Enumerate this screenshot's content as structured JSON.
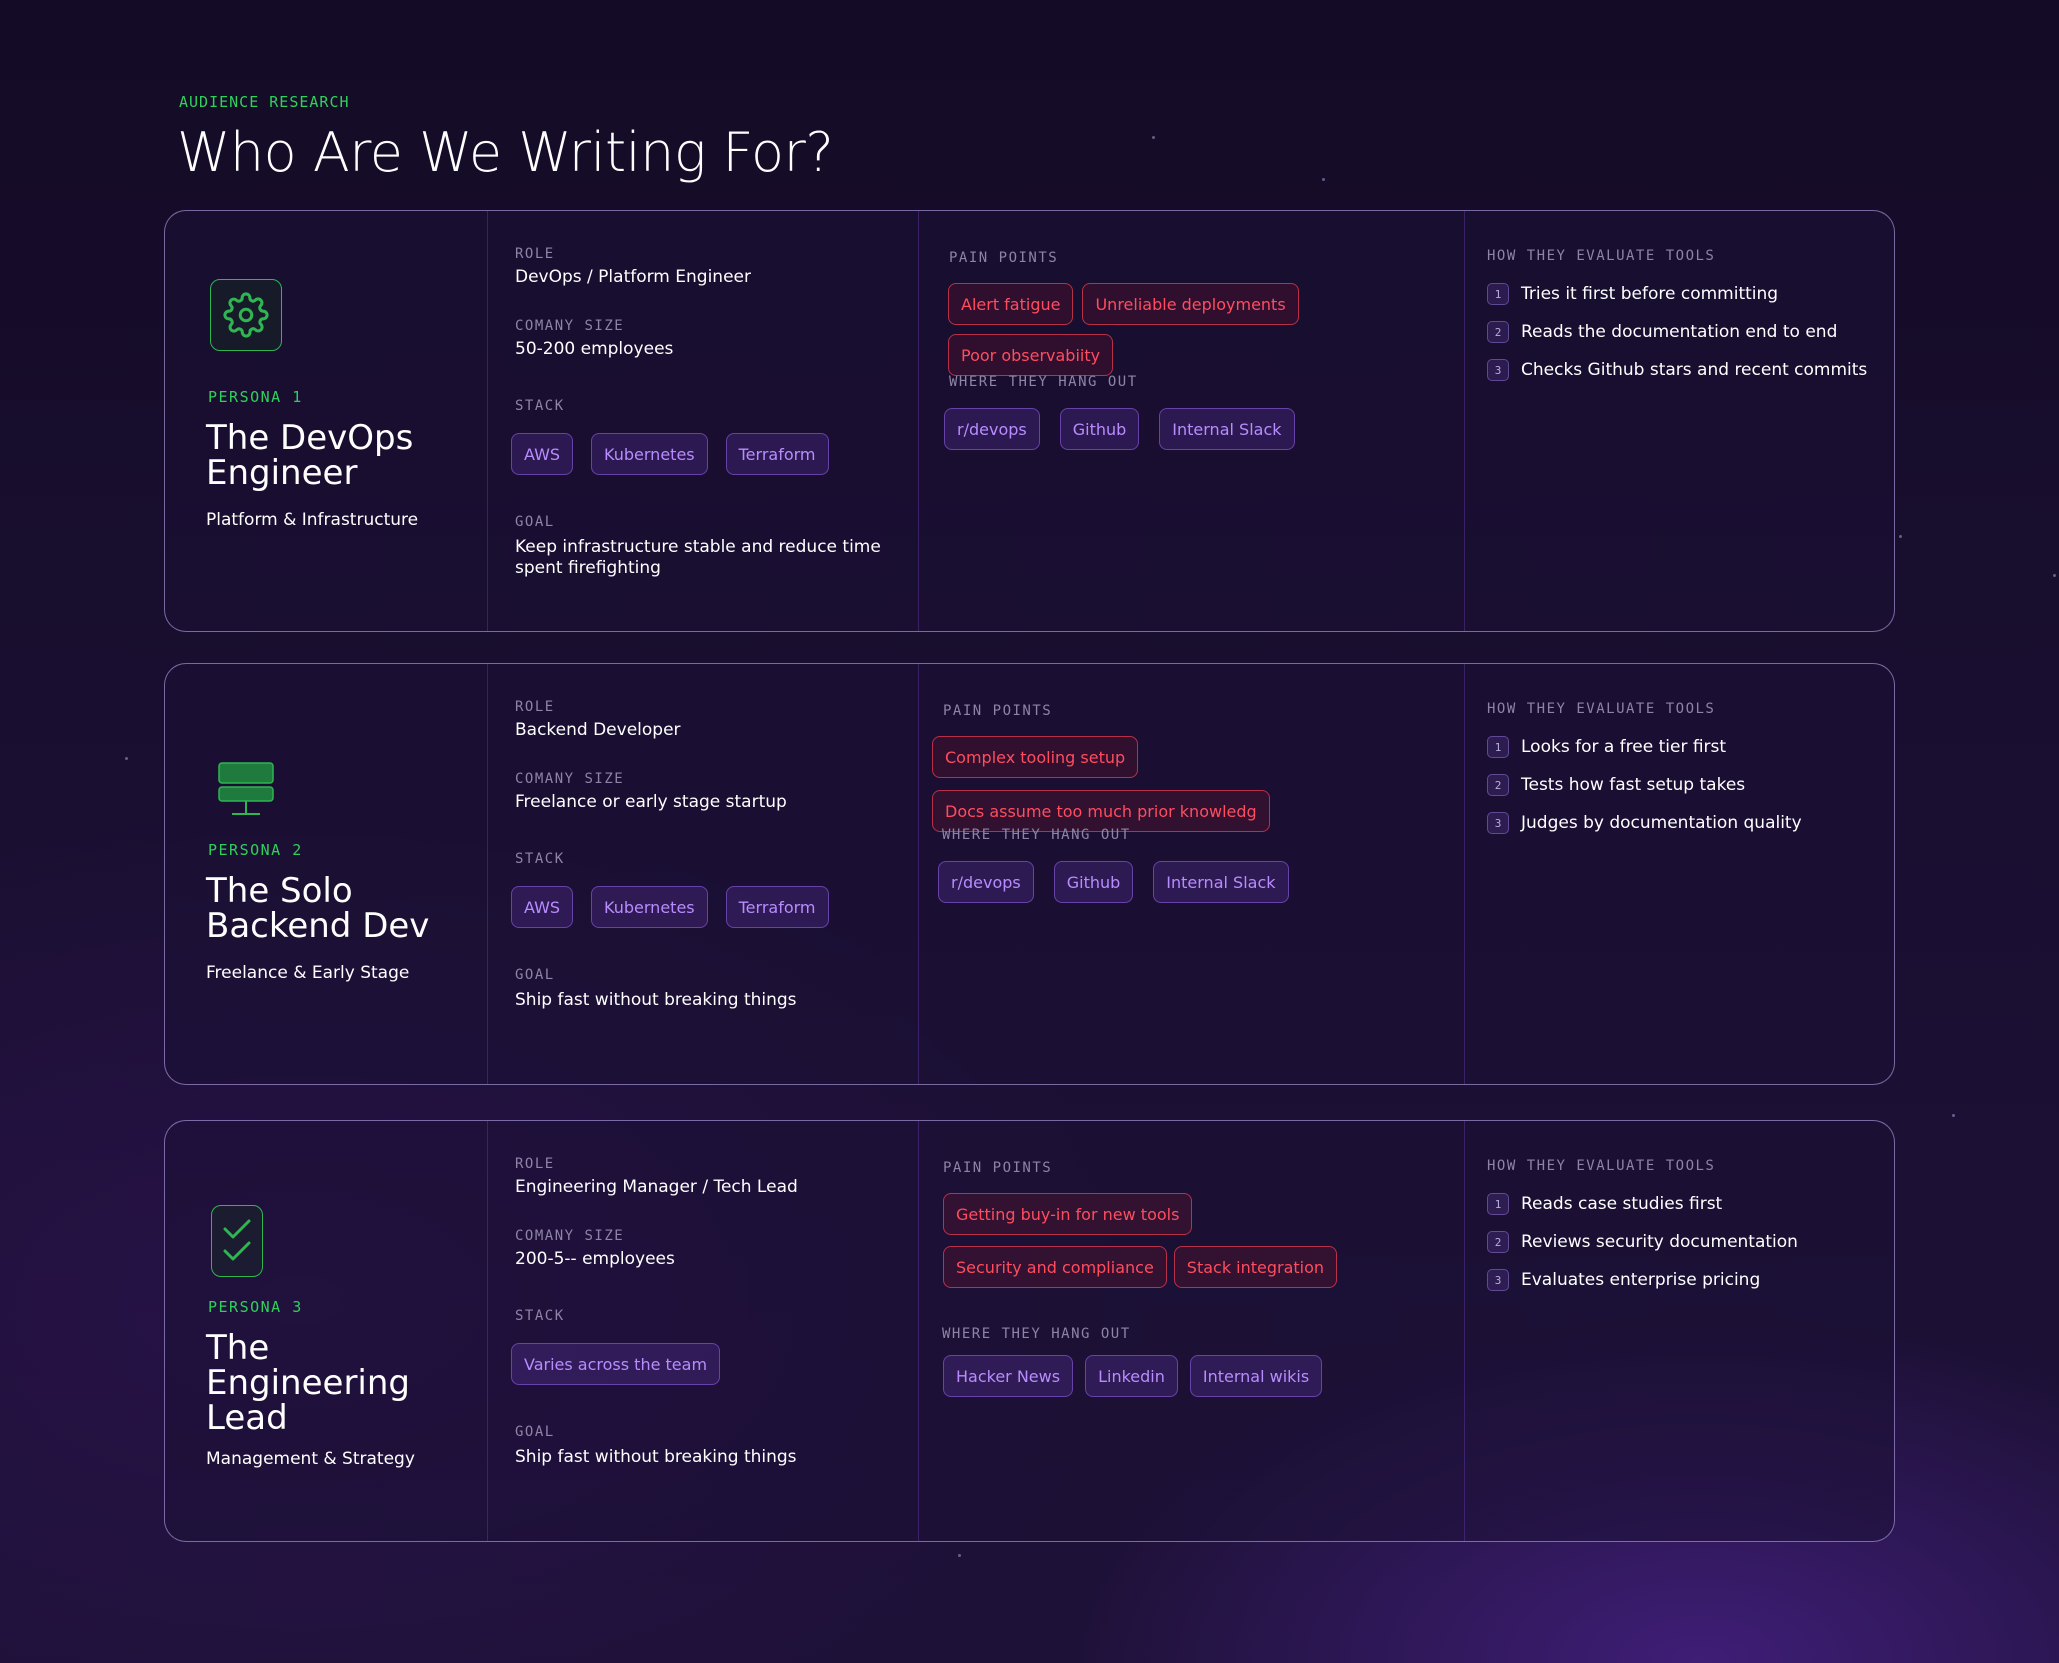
{
  "header": {
    "eyebrow": "AUDIENCE RESEARCH",
    "title": "Who Are We Writing For?"
  },
  "labels": {
    "role": "ROLE",
    "company_size": "COMANY SIZE",
    "stack": "STACK",
    "goal": "GOAL",
    "pain_points": "PAIN POINTS",
    "hang_out": "WHERE THEY HANG OUT",
    "evaluate": "HOW THEY EVALUATE TOOLS"
  },
  "colors": {
    "accent_green": "#2fd15a",
    "chip_purple": "#b88cff",
    "chip_red": "#ff4d5e"
  },
  "personas": [
    {
      "icon": "gear-icon",
      "number": "PERSONA 1",
      "name": "The DevOps Engineer",
      "subtitle": "Platform & Infrastructure",
      "role": "DevOps / Platform Engineer",
      "company_size": "50-200 employees",
      "stack": [
        "AWS",
        "Kubernetes",
        "Terraform"
      ],
      "goal": "Keep infrastructure stable and reduce time spent firefighting",
      "pain_points": [
        "Alert fatigue",
        "Unreliable deployments",
        "Poor observabiity"
      ],
      "hang_out": [
        "r/devops",
        "Github",
        "Internal Slack"
      ],
      "evaluate": [
        "Tries it first before committing",
        "Reads the documentation end to end",
        "Checks Github stars and recent commits"
      ]
    },
    {
      "icon": "server-icon",
      "number": "PERSONA 2",
      "name": "The Solo Backend Dev",
      "subtitle": "Freelance & Early Stage",
      "role": "Backend Developer",
      "company_size": "Freelance or early stage startup",
      "stack": [
        "AWS",
        "Kubernetes",
        "Terraform"
      ],
      "goal": "Ship fast without breaking things",
      "pain_points": [
        "Complex tooling setup",
        "Docs assume too much prior knowledg"
      ],
      "hang_out": [
        "r/devops",
        "Github",
        "Internal Slack"
      ],
      "evaluate": [
        "Looks for a free tier first",
        "Tests how fast setup takes",
        "Judges by documentation quality"
      ]
    },
    {
      "icon": "checklist-icon",
      "number": "PERSONA 3",
      "name": "The Engineering Lead",
      "subtitle": "Management & Strategy",
      "role": "Engineering Manager / Tech Lead",
      "company_size": "200-5-- employees",
      "stack": [
        "Varies across the team"
      ],
      "goal": "Ship fast without breaking things",
      "pain_points": [
        "Getting buy-in for new tools",
        "Security and compliance",
        "Stack integration"
      ],
      "hang_out": [
        "Hacker News",
        "Linkedin",
        "Internal wikis"
      ],
      "evaluate": [
        "Reads case studies first",
        "Reviews security documentation",
        "Evaluates enterprise pricing"
      ]
    }
  ]
}
